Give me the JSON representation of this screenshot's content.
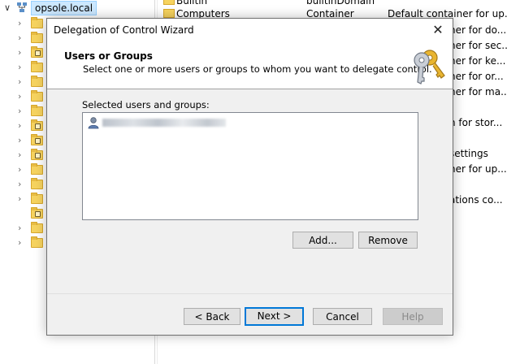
{
  "tree": {
    "root_label": "opsole.local",
    "rows": [
      {
        "type": "folder"
      },
      {
        "type": "folder"
      },
      {
        "type": "ou"
      },
      {
        "type": "folder"
      },
      {
        "type": "folder"
      },
      {
        "type": "folder"
      },
      {
        "type": "folder"
      },
      {
        "type": "ou"
      },
      {
        "type": "ou"
      },
      {
        "type": "ou"
      },
      {
        "type": "folder"
      },
      {
        "type": "folder"
      },
      {
        "type": "folder"
      },
      {
        "type": "ou"
      },
      {
        "type": "folder"
      },
      {
        "type": "folder"
      }
    ]
  },
  "list": {
    "rows": [
      {
        "name": "Builtin",
        "type": "builtinDomain",
        "description": ""
      },
      {
        "name": "Computers",
        "type": "Container",
        "description": "Default container for up..."
      }
    ],
    "description_tails": [
      "ner for do...",
      "ner for sec...",
      "ner for ke...",
      "ner for or...",
      "ner for ma...",
      "n for stor...",
      "settings",
      "ner for up...",
      "ations co..."
    ]
  },
  "dialog": {
    "title": "Delegation of Control Wizard",
    "close_glyph": "✕",
    "header_title": "Users or Groups",
    "header_subtitle": "Select one or more users or groups to whom you want to delegate control.",
    "selected_label": "Selected users and groups:",
    "add_label": "Add...",
    "remove_label": "Remove",
    "back_label": "< Back",
    "next_label": "Next >",
    "cancel_label": "Cancel",
    "help_label": "Help"
  },
  "icons": {
    "wizard": "keys-icon",
    "user": "user-icon",
    "folder": "folder-icon",
    "ou": "organizational-unit-icon",
    "domain": "domain-icon"
  },
  "colors": {
    "selection": "#cce8ff",
    "default_button_border": "#0078d7",
    "dialog_bg": "#f0f0f0"
  }
}
